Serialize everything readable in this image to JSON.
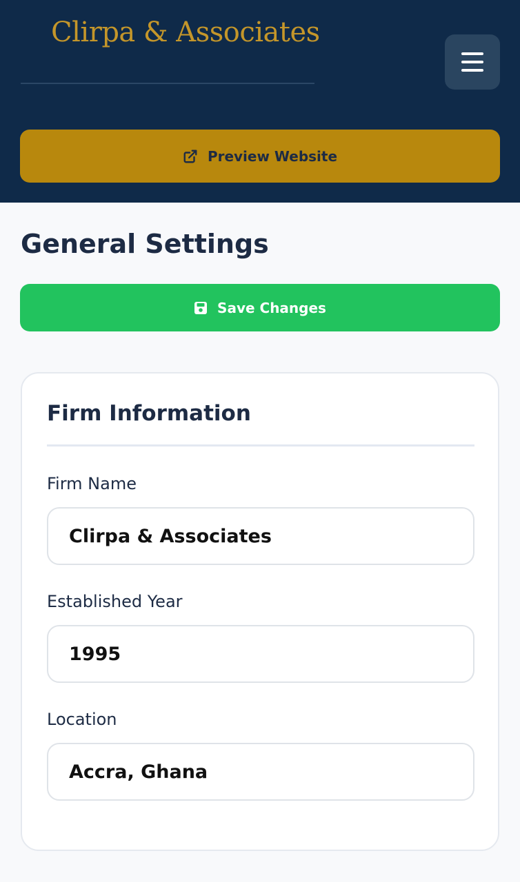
{
  "header": {
    "brand": "Clirpa & Associates",
    "menu_icon": "hamburger-menu-icon",
    "preview_label": "Preview Website",
    "preview_icon": "external-link-icon"
  },
  "page": {
    "title": "General Settings",
    "save_label": "Save Changes",
    "save_icon": "floppy-disk-icon"
  },
  "firm_info": {
    "title": "Firm Information",
    "fields": [
      {
        "label": "Firm Name",
        "value": "Clirpa & Associates"
      },
      {
        "label": "Established Year",
        "value": "1995"
      },
      {
        "label": "Location",
        "value": "Accra, Ghana"
      }
    ]
  },
  "colors": {
    "header_bg": "#0f2a49",
    "brand_gold": "#c4962a",
    "preview_btn": "#b8880d",
    "save_btn": "#22c35e",
    "text_dark": "#1d2b44"
  }
}
